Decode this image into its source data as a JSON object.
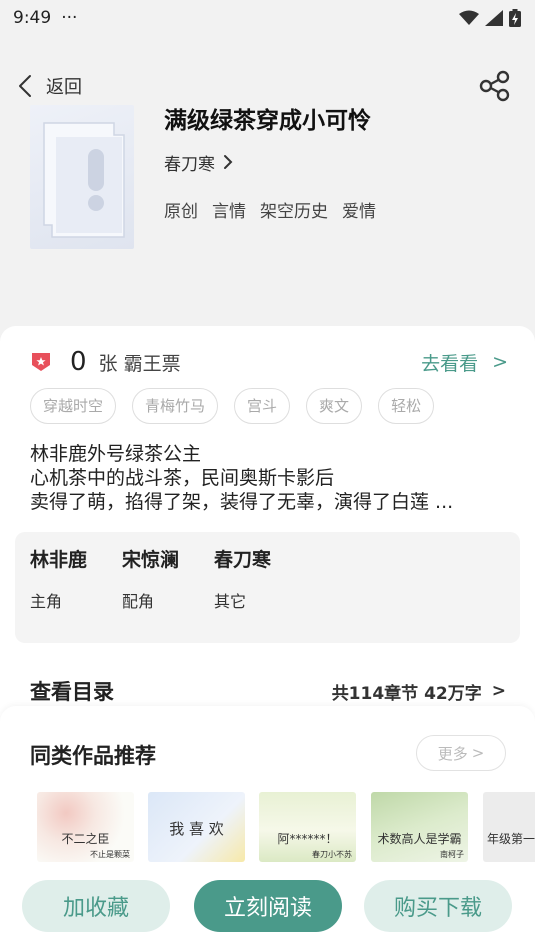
{
  "status_bar": {
    "time": "9:49",
    "more": "···"
  },
  "nav": {
    "back_label": "返回"
  },
  "book": {
    "title": "满级绿茶穿成小可怜",
    "author": "春刀寒",
    "categories": [
      "原创",
      "言情",
      "架空历史",
      "爱情"
    ]
  },
  "vote": {
    "count": "0",
    "label": "张 霸王票",
    "link": "去看看",
    "link_arrow": ">"
  },
  "tags": [
    "穿越时空",
    "青梅竹马",
    "宫斗",
    "爽文",
    "轻松"
  ],
  "synopsis": [
    "林非鹿外号绿茶公主",
    "心机茶中的战斗茶，民间奥斯卡影后",
    "卖得了萌，掐得了架，装得了无辜，演得了白莲 ..."
  ],
  "characters": [
    {
      "name": "林非鹿",
      "role": "主角"
    },
    {
      "name": "宋惊澜",
      "role": "配角"
    },
    {
      "name": "春刀寒",
      "role": "其它"
    }
  ],
  "toc": {
    "title": "查看目录",
    "info": "共114章节 42万字",
    "arrow": ">"
  },
  "recommend": {
    "title": "同类作品推荐",
    "more": "更多",
    "more_arrow": ">",
    "items": [
      {
        "title": "不二之臣",
        "sub": "不止是颗菜"
      },
      {
        "title": "我 喜 欢",
        "sub": ""
      },
      {
        "title": "阿******！",
        "sub": "春刀小不苏"
      },
      {
        "title": "术数高人是学霸",
        "sub": "南柯子"
      },
      {
        "title": "年级第一",
        "sub": ""
      }
    ]
  },
  "actions": {
    "collect": "加收藏",
    "read": "立刻阅读",
    "buy": "购买下载"
  },
  "colors": {
    "accent": "#4a9a8a",
    "accent_light": "#dfeeea",
    "badge_red": "#e8505b"
  }
}
